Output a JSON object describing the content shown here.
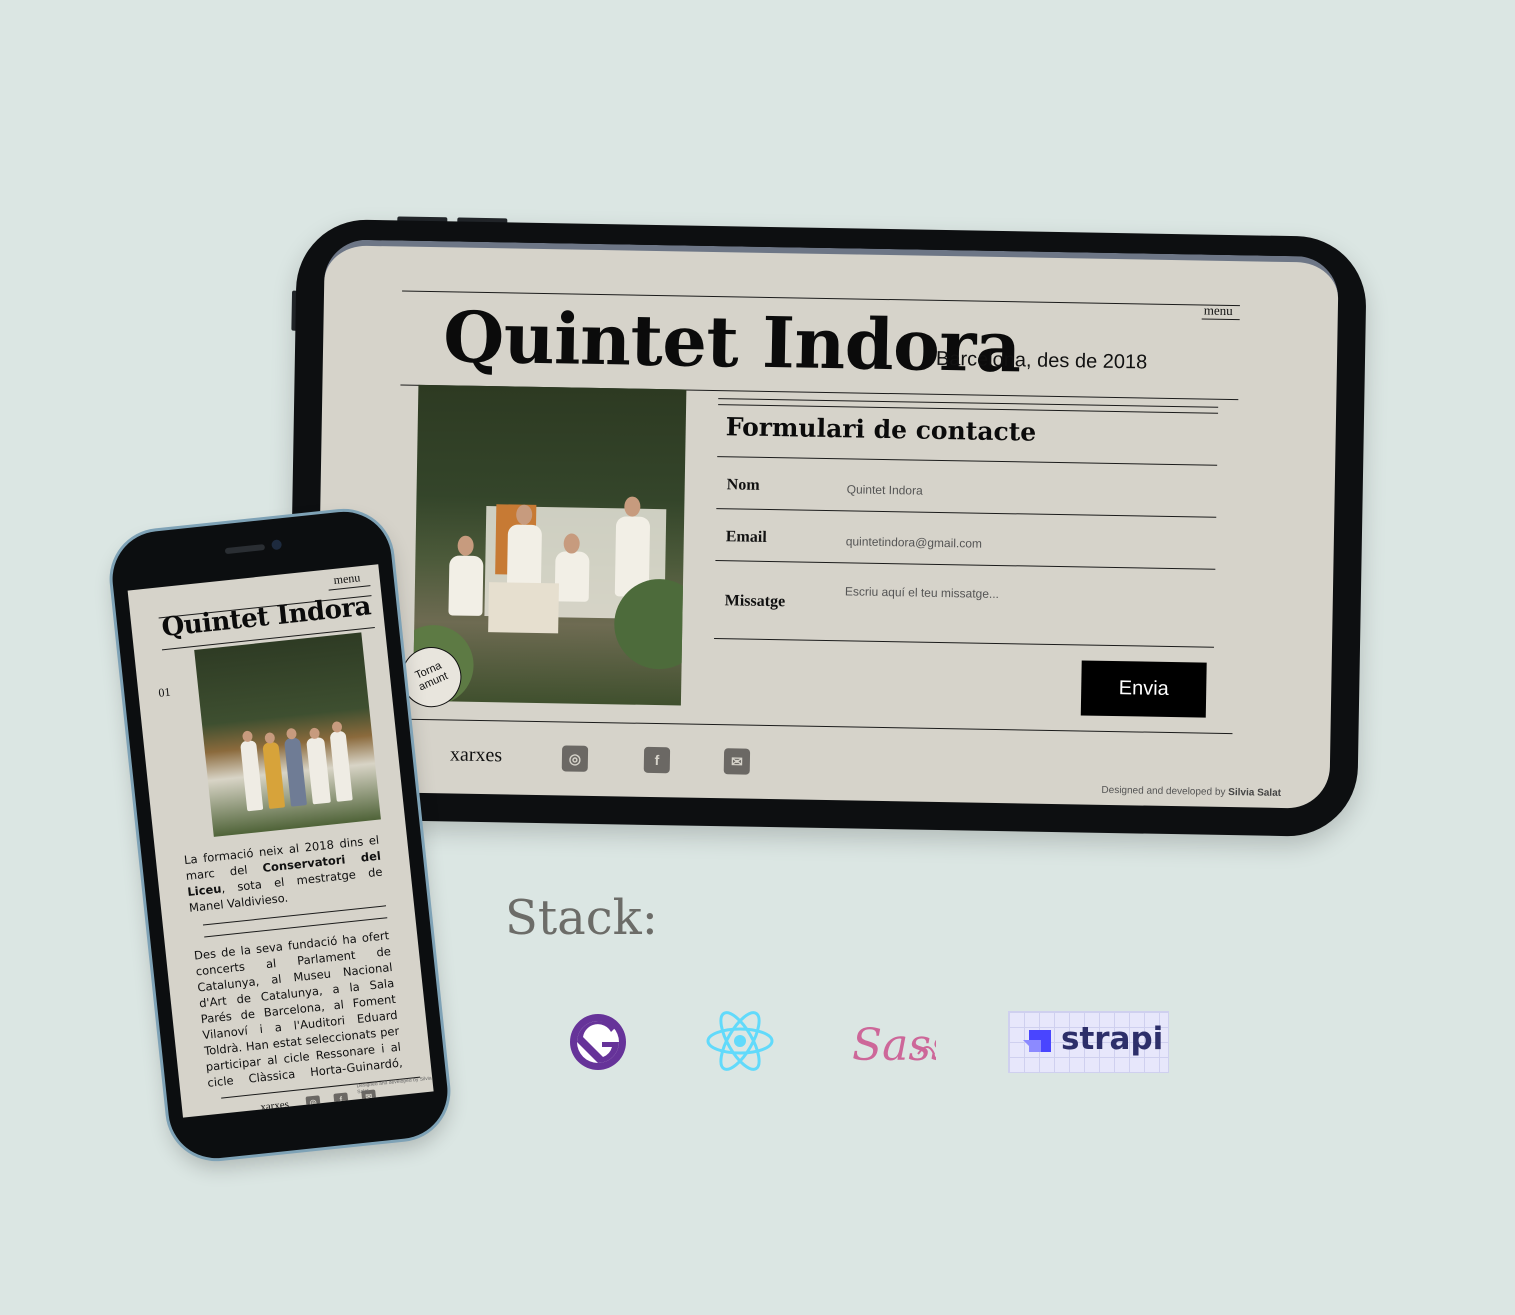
{
  "tablet": {
    "menu": "menu",
    "title": "Quintet Indora",
    "subtitle": "Barcelona, des de 2018",
    "back_to_top": "Torna amunt",
    "form": {
      "title": "Formulari de contacte",
      "name_label": "Nom",
      "name_value": "Quintet Indora",
      "email_label": "Email",
      "email_value": "quintetindora@gmail.com",
      "message_label": "Missatge",
      "message_placeholder": "Escriu aquí el teu missatge...",
      "submit": "Envia"
    },
    "footer": {
      "networks": "xarxes",
      "icons": [
        "instagram-icon",
        "facebook-icon",
        "mail-icon"
      ],
      "credit_prefix": "Designed and developed by",
      "credit_name": "Silvia Salat"
    }
  },
  "phone": {
    "menu": "menu",
    "title": "Quintet Indora",
    "section_number": "01",
    "paragraph1_a": "La formació neix al 2018 dins el marc del ",
    "paragraph1_bold": "Conservatori del Liceu",
    "paragraph1_b": ", sota el mestratge de Manel Valdivieso.",
    "paragraph2": "Des de la seva fundació ha ofert concerts al Parlament de Catalunya, al Museu Nacional d'Art de Catalunya, a la Sala Parés de Barcelona, al Foment Vilanoví i a l'Auditori Eduard Toldrà. Han estat seleccionats per participar al cicle Ressonare i al cicle Clàssica Horta-Guinardó, organitzats per",
    "footer": {
      "networks": "xarxes",
      "credit": "Designed and developed by Silvia Salat"
    }
  },
  "stack": {
    "label": "Stack:",
    "logos": [
      "gatsby-logo",
      "react-logo",
      "sass-logo",
      "strapi-logo"
    ],
    "strapi_text": "strapi",
    "sass_text": "Sass",
    "colors": {
      "gatsby": "#663399",
      "react": "#61dafb",
      "sass": "#cd6799",
      "strapi": "#4945ff"
    }
  }
}
